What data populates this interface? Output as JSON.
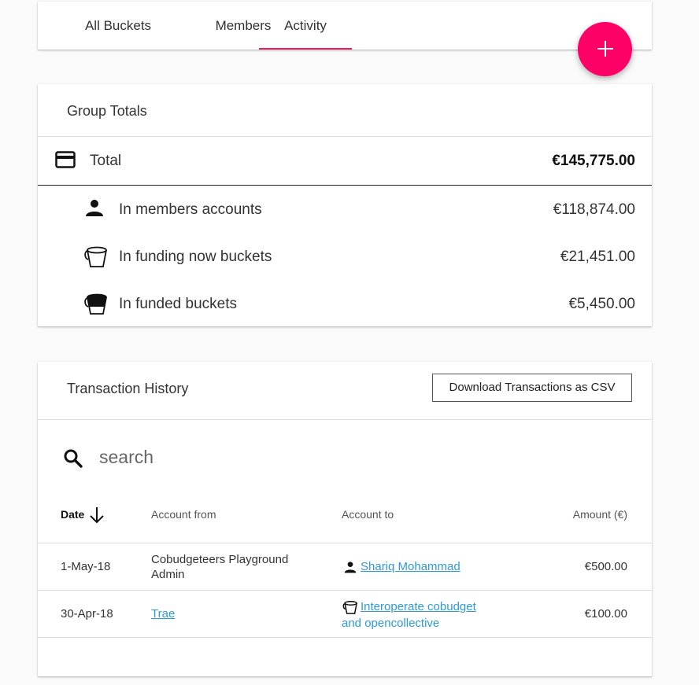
{
  "tabs": [
    {
      "label": "All Buckets"
    },
    {
      "label": "Members"
    },
    {
      "label": "Activity"
    }
  ],
  "colors": {
    "accent": "#e91e63",
    "fab": "#ff0066",
    "link": "#2d9bd6"
  },
  "group_totals": {
    "title": "Group Totals",
    "total": {
      "label": "Total",
      "amount": "€145,775.00",
      "icon": "credit-card-icon"
    },
    "rows": [
      {
        "label": "In members accounts",
        "amount": "€118,874.00",
        "icon": "person-icon"
      },
      {
        "label": "In funding now buckets",
        "amount": "€21,451.00",
        "icon": "empty-bucket-icon"
      },
      {
        "label": "In funded buckets",
        "amount": "€5,450.00",
        "icon": "full-bucket-icon"
      }
    ]
  },
  "transactions": {
    "title": "Transaction History",
    "download_label": "Download Transactions as CSV",
    "search_placeholder": "search",
    "columns": {
      "date": "Date",
      "from": "Account from",
      "to": "Account to",
      "amount": "Amount (€)"
    },
    "rows": [
      {
        "date": "1-May-18",
        "from_line1": "Cobudgeteers Playground",
        "from_line2": "Admin",
        "to_line1": "Shariq Mohammad",
        "to_line2": "",
        "to_icon": "person-icon",
        "amount": "€500.00"
      },
      {
        "date": "30-Apr-18",
        "from_line1": "Trae",
        "from_line2": "",
        "to_line1": "Interoperate cobudget",
        "to_line2": "and opencollective",
        "to_icon": "empty-bucket-icon",
        "amount": "€100.00"
      }
    ]
  }
}
